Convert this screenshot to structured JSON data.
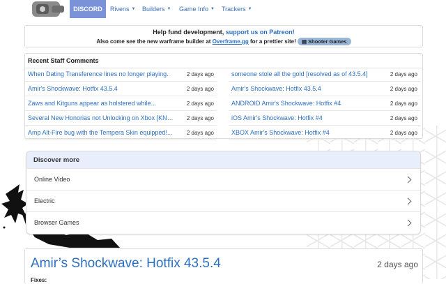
{
  "nav": {
    "discord": "DISCORD",
    "items": [
      {
        "label": "Rivens"
      },
      {
        "label": "Builders"
      },
      {
        "label": "Game Info"
      },
      {
        "label": "Trackers"
      }
    ]
  },
  "fund": {
    "line1_prefix": "Help fund development, ",
    "line1_link": "support us on Patreon!",
    "line2_prefix": "Also come see the new warframe builder at ",
    "line2_link": "Overframe.gg",
    "line2_suffix": " for a prettier site! ",
    "badge": "▤ Shooter Games"
  },
  "recent": {
    "title": "Recent Staff Comments",
    "left": [
      {
        "title": "When Dating Transference lines no longer playing.",
        "date": "2 days ago"
      },
      {
        "title": "Amir's Shockwave: Hotfix 43.5.4",
        "date": "2 days ago"
      },
      {
        "title": "Zaws and Kitguns appear as holstered while...",
        "date": "2 days ago"
      },
      {
        "title": "Several New Honorias not Unlocking on Xbox [KNOWN...",
        "date": "2 days ago"
      },
      {
        "title": "Amp Alt-Fire bug with the Tempera Skin equipped!...",
        "date": "2 days ago"
      }
    ],
    "right": [
      {
        "title": "someone stole all the gold [resolved as of 43.5.4]",
        "date": "2 days ago"
      },
      {
        "title": "Amir's Shockwave: Hotfix 43.5.4",
        "date": "2 days ago"
      },
      {
        "title": "ANDROID Amir's Shockwave: Hotfix #4",
        "date": "2 days ago"
      },
      {
        "title": "iOS Amir's Shockwave: Hotfix #4",
        "date": "2 days ago"
      },
      {
        "title": "XBOX Amir's Shockwave: Hotfix #4",
        "date": "2 days ago"
      }
    ]
  },
  "discover": {
    "title": "Discover more",
    "items": [
      "Online Video",
      "Electric",
      "Browser Games"
    ]
  },
  "article": {
    "title": "Amir’s Shockwave: Hotfix 43.5.4",
    "date": "2 days ago",
    "fixes": "Fixes:"
  }
}
